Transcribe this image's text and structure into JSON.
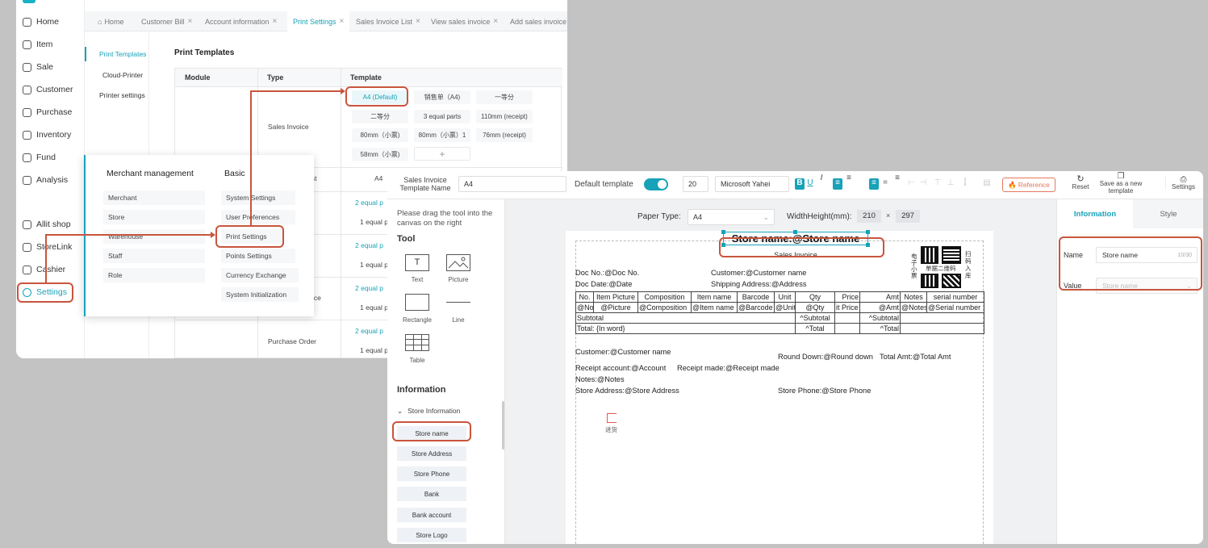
{
  "app": {
    "sidebar": {
      "items": [
        {
          "label": "Home",
          "icon": "home-icon"
        },
        {
          "label": "Item",
          "icon": "item-icon"
        },
        {
          "label": "Sale",
          "icon": "sale-icon"
        },
        {
          "label": "Customer",
          "icon": "customer-icon"
        },
        {
          "label": "Purchase",
          "icon": "purchase-icon"
        },
        {
          "label": "Inventory",
          "icon": "inventory-icon"
        },
        {
          "label": "Fund",
          "icon": "fund-icon"
        },
        {
          "label": "Analysis",
          "icon": "analysis-icon"
        },
        {
          "label": "Allit shop",
          "icon": "shop-icon"
        },
        {
          "label": "StoreLink",
          "icon": "link-icon"
        },
        {
          "label": "Cashier",
          "icon": "cashier-icon"
        },
        {
          "label": "Settings",
          "icon": "gear-icon"
        }
      ]
    },
    "tabs": [
      "Home",
      "Customer Bill",
      "Account information",
      "Print Settings",
      "Sales Invoice List",
      "View sales invoice",
      "Add sales invoice"
    ],
    "tab_close": "×",
    "subnav": [
      "Print Templates",
      "Cloud-Printer",
      "Printer settings"
    ],
    "page_title": "Print Templates",
    "table": {
      "headers": [
        "Module",
        "Type",
        "Template"
      ],
      "row1_type": "Sales Invoice",
      "row1_templates": [
        "A4 (Default)",
        "销售单（A4)",
        "一等分",
        "二等分",
        "3 equal parts",
        "110mm (receipt)",
        "80mm（小票)",
        "80mm（小票）1",
        "76mm (receipt)",
        "58mm（小票)",
        "+"
      ],
      "row2_type_partial": "ist",
      "row2_template": "A4",
      "row3_template_a": "2 equal p",
      "row3_template_b": "1 equal p",
      "row4_type_partial": "ice",
      "row4_template_a": "2 equal p",
      "row4_template_b": "1 equal p",
      "row5_type": "Purchase Order",
      "row5_template_a": "2 equal p",
      "row5_template_b": "1 equal p"
    },
    "popup": {
      "col1_title": "Merchant management",
      "col1_items": [
        "Merchant",
        "Store",
        "Warehouse",
        "Staff",
        "Role"
      ],
      "col2_title": "Basic",
      "col2_items": [
        "System Settings",
        "User Preferences",
        "Print Settings",
        "Points Settings",
        "Currency Exchange",
        "System Initialization"
      ]
    }
  },
  "editor": {
    "toolbar": {
      "template_name_label": "Sales Invoice Template Name",
      "template_name_value": "A4",
      "default_template_label": "Default template",
      "font_size": "20",
      "font_family": "Microsoft Yahei",
      "bold": "B",
      "underline": "U",
      "italic": "I",
      "reference_label": "Reference",
      "reset_label": "Reset",
      "save_new_label": "Save as a new template",
      "settings_label": "Settings"
    },
    "left": {
      "hint": "Please drag the tool into the canvas on the right",
      "tool_title": "Tool",
      "tools": [
        "Text",
        "Picture",
        "Rectangle",
        "Line",
        "Table"
      ],
      "text_glyph": "T",
      "info_title": "Information",
      "group_label": "Store Information",
      "fields": [
        "Store name",
        "Store Address",
        "Store Phone",
        "Bank",
        "Bank account",
        "Store Logo"
      ]
    },
    "canvas": {
      "paper_type_label": "Paper Type:",
      "paper_type_value": "A4",
      "wh_label": "WidthHeight(mm):",
      "width": "210",
      "times": "×",
      "height": "297",
      "store_title": "Store name:@Store name",
      "subtitle": "Sales Invoice",
      "doc_no": "Doc No.:@Doc No.",
      "doc_date": "Doc Date:@Date",
      "customer": "Customer:@Customer name",
      "shipping": "Shipping Address:@Address",
      "qr_left": "电子小票",
      "qr_mid": "单据二维码",
      "qr_right": "扫码入库",
      "headers": [
        "No.",
        "Item Picture",
        "Composition",
        "Item name",
        "Barcode",
        "Unit",
        "Qty",
        "Price",
        "Amt",
        "Notes",
        "serial number"
      ],
      "row": [
        "@No",
        "@Picture",
        "@Composition",
        "@Item name",
        "@Barcode",
        "@Unit",
        "@Qty",
        "it Price",
        "@Amt",
        "@Notes",
        "@Serial number"
      ],
      "subtotal_label": "Subtotal",
      "subtotal_qty": "^Subtotal",
      "subtotal_amt": "^Subtotal",
      "total_label": "Total: {In word}",
      "total_qty": "^Total",
      "total_amt": "^Total",
      "customer2": "Customer:@Customer name",
      "round_down": "Round Down:@Round down",
      "total_amt_label": "Total Amt:@Total Amt",
      "receipt_account": "Receipt account:@Account",
      "receipt_made": "Receipt made:@Receipt made",
      "notes": "Notes:@Notes",
      "store_address": "Store Address:@Store Address",
      "store_phone": "Store Phone:@Store Phone",
      "stamp_text": "进货"
    },
    "right": {
      "tabs": [
        "Information",
        "Style"
      ],
      "name_label": "Name",
      "name_value": "Store name",
      "name_count": "10/30",
      "value_label": "Value",
      "value_placeholder": "Store name"
    }
  },
  "colors": {
    "accent": "#17a2b8",
    "highlight": "#c8553d"
  }
}
